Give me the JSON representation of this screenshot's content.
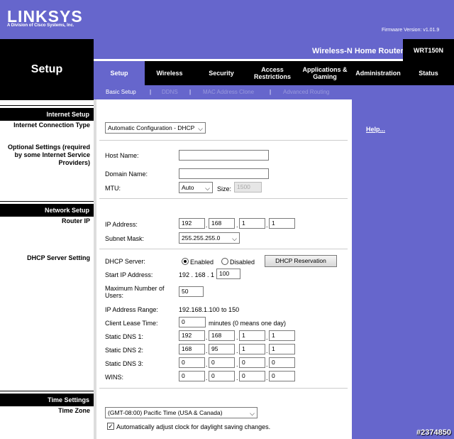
{
  "header": {
    "logo": "LINKSYS",
    "logo_sub": "A Division of Cisco Systems, Inc.",
    "firmware": "Firmware Version: v1.01.9",
    "router_name": "Wireless-N Home Router",
    "model": "WRT150N",
    "page_title": "Setup"
  },
  "tabs": [
    {
      "label": "Setup"
    },
    {
      "label": "Wireless"
    },
    {
      "label": "Security"
    },
    {
      "label": "Access Restrictions"
    },
    {
      "label": "Applications & Gaming"
    },
    {
      "label": "Administration"
    },
    {
      "label": "Status"
    }
  ],
  "subtabs": [
    {
      "label": "Basic Setup"
    },
    {
      "label": "DDNS"
    },
    {
      "label": "MAC Address Clone"
    },
    {
      "label": "Advanced Routing"
    }
  ],
  "sections": {
    "internet_setup": "Internet Setup",
    "connection_type": "Internet Connection Type",
    "optional_settings": "Optional Settings (required by some Internet Service Providers)",
    "network_setup": "Network Setup",
    "router_ip": "Router IP",
    "dhcp_server_setting": "DHCP Server Setting",
    "time_settings": "Time Settings",
    "time_zone": "Time Zone"
  },
  "help_link": "Help...",
  "internet": {
    "connection_type_value": "Automatic Configuration - DHCP",
    "host_name_label": "Host Name:",
    "host_name_value": "",
    "domain_name_label": "Domain Name:",
    "domain_name_value": "",
    "mtu_label": "MTU:",
    "mtu_value": "Auto",
    "size_label": "Size:",
    "size_value": "1500"
  },
  "router": {
    "ip_label": "IP Address:",
    "ip": [
      "192",
      "168",
      "1",
      "1"
    ],
    "mask_label": "Subnet Mask:",
    "mask_value": "255.255.255.0"
  },
  "dhcp": {
    "server_label": "DHCP Server:",
    "enabled_label": "Enabled",
    "disabled_label": "Disabled",
    "enabled": true,
    "reservation_button": "DHCP Reservation",
    "start_ip_label": "Start IP Address:",
    "start_ip_prefix": "192 . 168 . 1 .",
    "start_ip_value": "100",
    "max_users_label": "Maximum Number of Users:",
    "max_users_value": "50",
    "range_label": "IP Address Range:",
    "range_value": "192.168.1.100 to 150",
    "lease_label": "Client Lease Time:",
    "lease_value": "0",
    "lease_suffix": "minutes (0 means one day)",
    "dns1_label": "Static DNS 1:",
    "dns1": [
      "192",
      "168",
      "1",
      "1"
    ],
    "dns2_label": "Static DNS 2:",
    "dns2": [
      "168",
      "95",
      "1",
      "1"
    ],
    "dns3_label": "Static DNS 3:",
    "dns3": [
      "0",
      "0",
      "0",
      "0"
    ],
    "wins_label": "WINS:",
    "wins": [
      "0",
      "0",
      "0",
      "0"
    ]
  },
  "time": {
    "zone_value": "(GMT-08:00) Pacific Time (USA & Canada)",
    "dst_label": "Automatically adjust clock for daylight saving changes.",
    "dst_checked": true
  },
  "watermark": "#2374850"
}
